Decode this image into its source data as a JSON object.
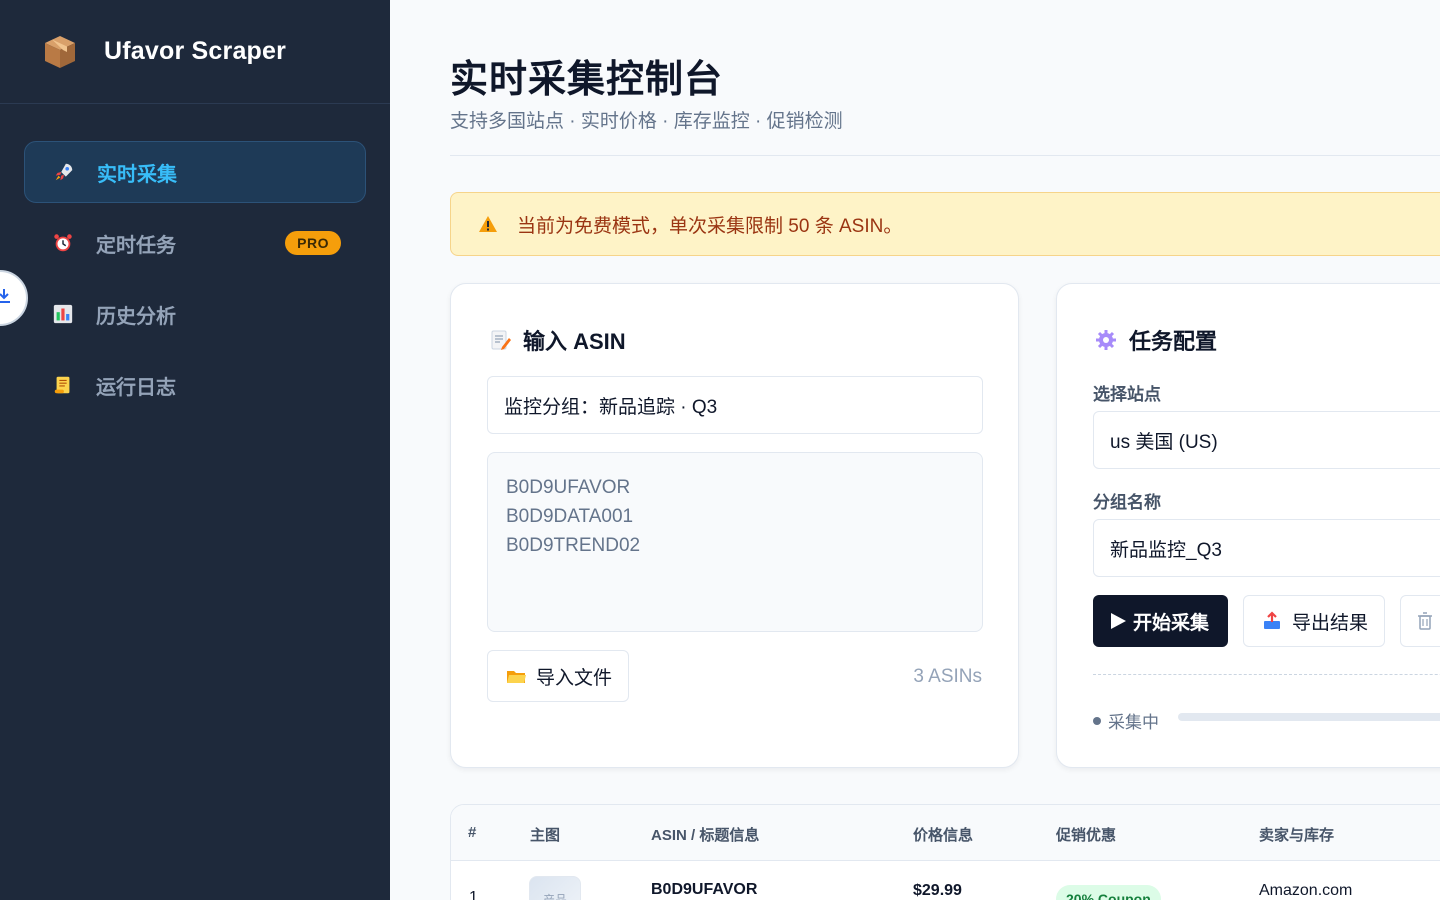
{
  "app": {
    "name": "Ufavor Scraper"
  },
  "sidebar": {
    "items": [
      {
        "label": "实时采集",
        "icon": "rocket-icon",
        "active": true
      },
      {
        "label": "定时任务",
        "icon": "alarm-clock-icon",
        "badge": "PRO"
      },
      {
        "label": "历史分析",
        "icon": "bar-chart-icon"
      },
      {
        "label": "运行日志",
        "icon": "scroll-icon"
      }
    ]
  },
  "header": {
    "title": "实时采集控制台",
    "subtitle": "支持多国站点 · 实时价格 · 库存监控 · 促销检测"
  },
  "alert": {
    "text": "当前为免费模式，单次采集限制 50 条 ASIN。",
    "icon": "warning-icon"
  },
  "input_card": {
    "title": "输入 ASIN",
    "group_value": "监控分组：新品追踪 · Q3",
    "asins": [
      "B0D9UFAVOR",
      "B0D9DATA001",
      "B0D9TREND02"
    ],
    "import_label": "导入文件",
    "count_label": "3 ASINs"
  },
  "config_card": {
    "title": "任务配置",
    "site_label": "选择站点",
    "site_value": "us 美国 (US)",
    "group_label": "分组名称",
    "group_value": "新品监控_Q3",
    "start_label": "开始采集",
    "export_label": "导出结果",
    "clear_label": "清",
    "status_label": "采集中",
    "progress": 0
  },
  "table": {
    "columns": [
      "#",
      "主图",
      "ASIN / 标题信息",
      "价格信息",
      "促销优惠",
      "卖家与库存"
    ],
    "rows": [
      {
        "index": "1",
        "thumb_label": "产品",
        "asin": "B0D9UFAVOR",
        "price": "$29.99",
        "promo": "20% Coupon",
        "seller": "Amazon.com"
      }
    ]
  },
  "colors": {
    "sidebar_bg": "#1e293b",
    "accent": "#38bdf8",
    "pro_badge": "#f59e0b",
    "alert_bg": "#fef3c7",
    "primary_button": "#0f172a"
  }
}
